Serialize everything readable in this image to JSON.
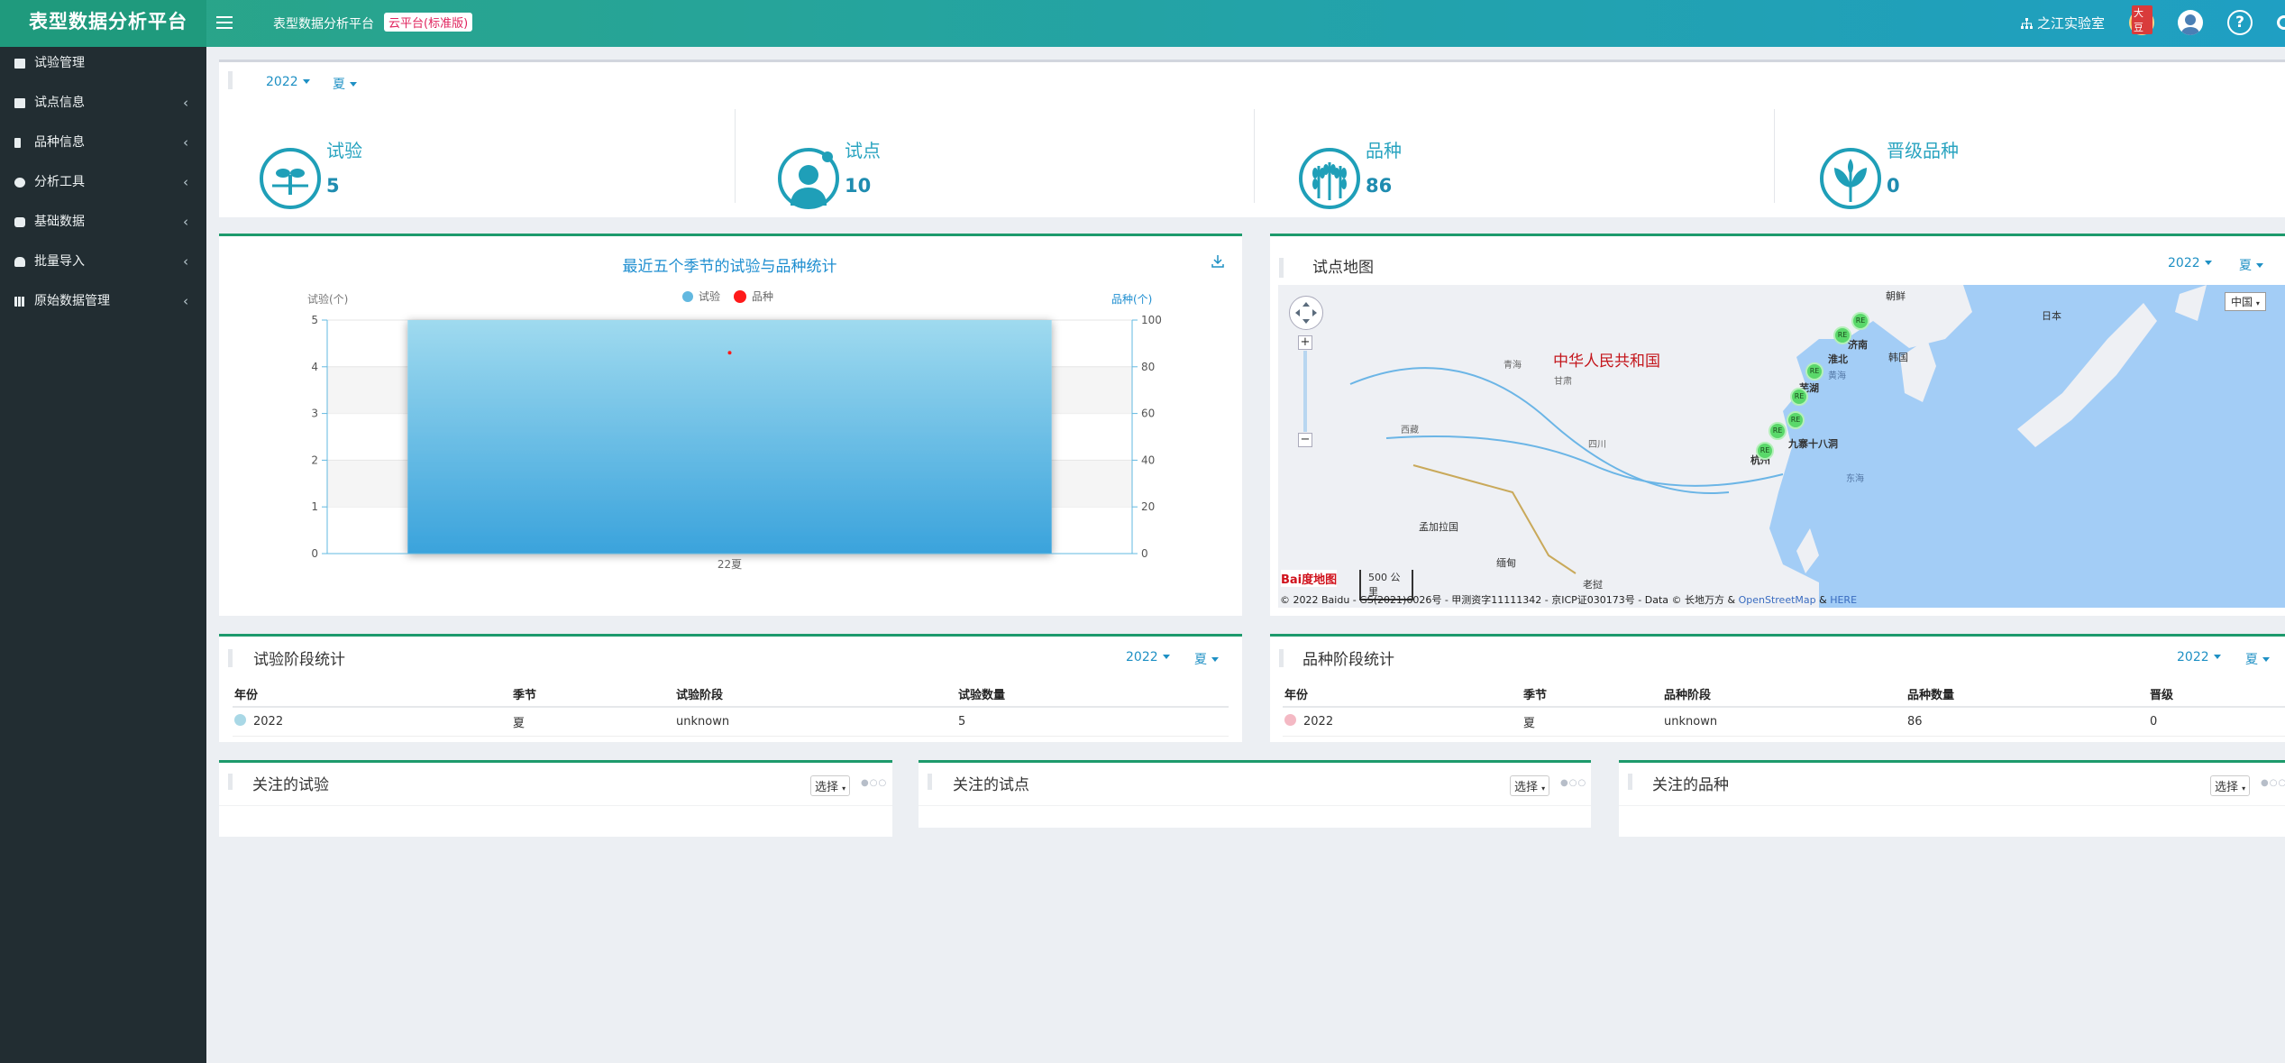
{
  "app": {
    "brand": "表型数据分析平台",
    "title": "表型数据分析平台",
    "badge": "云平台(标准版)",
    "lab": "之江实验室",
    "dou_label": "大豆",
    "help": "?"
  },
  "sidebar": {
    "items": [
      {
        "label": "试验管理",
        "icon": "home-icon",
        "chevron": ""
      },
      {
        "label": "试点信息",
        "icon": "map-icon",
        "chevron": "‹"
      },
      {
        "label": "品种信息",
        "icon": "seedling-icon",
        "chevron": "‹"
      },
      {
        "label": "分析工具",
        "icon": "pie-chart-icon",
        "chevron": "‹"
      },
      {
        "label": "基础数据",
        "icon": "database-icon",
        "chevron": "‹"
      },
      {
        "label": "批量导入",
        "icon": "cloud-upload-icon",
        "chevron": "‹"
      },
      {
        "label": "原始数据管理",
        "icon": "grid-icon",
        "chevron": "‹"
      }
    ]
  },
  "filters": {
    "year": "2022",
    "season": "夏"
  },
  "stats": [
    {
      "label": "试验",
      "value": "5",
      "icon": "sprout-icon"
    },
    {
      "label": "试点",
      "value": "10",
      "icon": "location-person-icon"
    },
    {
      "label": "品种",
      "value": "86",
      "icon": "wheat-icon"
    },
    {
      "label": "晋级品种",
      "value": "0",
      "icon": "leaf-plant-icon"
    }
  ],
  "chart_data": {
    "type": "bar",
    "title": "最近五个季节的试验与品种统计",
    "categories": [
      "22夏"
    ],
    "series": [
      {
        "name": "试验",
        "values": [
          5
        ],
        "axis": "left",
        "color": "#62b8e0"
      },
      {
        "name": "品种",
        "values": [
          86
        ],
        "axis": "right",
        "color": "#ff1a1a"
      }
    ],
    "ylabel_left": "试验(个)",
    "ylabel_right": "品种(个)",
    "ylim_left": [
      0,
      5
    ],
    "ylim_right": [
      0,
      100
    ],
    "yticks_left": [
      "0",
      "1",
      "2",
      "3",
      "4",
      "5"
    ],
    "yticks_right": [
      "0",
      "20",
      "40",
      "60",
      "80",
      "100"
    ],
    "legend": "top-center",
    "grid": true
  },
  "map_panel": {
    "title": "试点地图",
    "year": "2022",
    "season": "夏",
    "region_select": "中国",
    "country_label": "中华人民共和国",
    "labels": [
      "朝鲜",
      "日本",
      "韩国",
      "济南",
      "淮北",
      "黄海",
      "芜湖",
      "九寨十八洞",
      "杭州",
      "东海",
      "孟加拉国",
      "缅甸",
      "老挝",
      "西藏",
      "四川",
      "甘肃",
      "青海"
    ],
    "marker": "RE",
    "scale": "500 公里",
    "baidu": "Bai度地图",
    "copyright": "© 2022 Baidu - GS(2021)6026号 - 甲测资字11111342 - 京ICP证030173号 - Data © 长地万方 &",
    "osm": "OpenStreetMap",
    "amp": "&",
    "here": "HERE"
  },
  "trial_stage": {
    "title": "试验阶段统计",
    "year": "2022",
    "season": "夏",
    "columns": [
      "年份",
      "季节",
      "试验阶段",
      "试验数量"
    ],
    "rows": [
      {
        "year": "2022",
        "season": "夏",
        "stage": "unknown",
        "count": "5"
      }
    ]
  },
  "variety_stage": {
    "title": "品种阶段统计",
    "year": "2022",
    "season": "夏",
    "columns": [
      "年份",
      "季节",
      "品种阶段",
      "品种数量",
      "晋级"
    ],
    "rows": [
      {
        "year": "2022",
        "season": "夏",
        "stage": "unknown",
        "count": "86",
        "promoted": "0"
      }
    ]
  },
  "follows": [
    {
      "title": "关注的试验",
      "select": "选择"
    },
    {
      "title": "关注的试点",
      "select": "选择"
    },
    {
      "title": "关注的品种",
      "select": "选择"
    }
  ],
  "loader": "●○○"
}
